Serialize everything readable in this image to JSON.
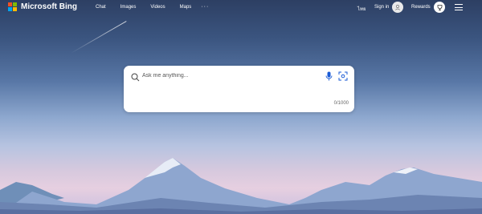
{
  "header": {
    "brand": "Microsoft Bing",
    "nav": [
      {
        "label": "Chat"
      },
      {
        "label": "Images"
      },
      {
        "label": "Videos"
      },
      {
        "label": "Maps"
      }
    ],
    "more_label": "···",
    "language": "ไทย",
    "signin_label": "Sign in",
    "rewards_label": "Rewards"
  },
  "search": {
    "placeholder": "Ask me anything...",
    "value": "",
    "counter": "0/1000"
  },
  "colors": {
    "accent": "#1a5bd6",
    "logo": [
      "#f25022",
      "#7fba00",
      "#00a4ef",
      "#ffb900"
    ]
  }
}
